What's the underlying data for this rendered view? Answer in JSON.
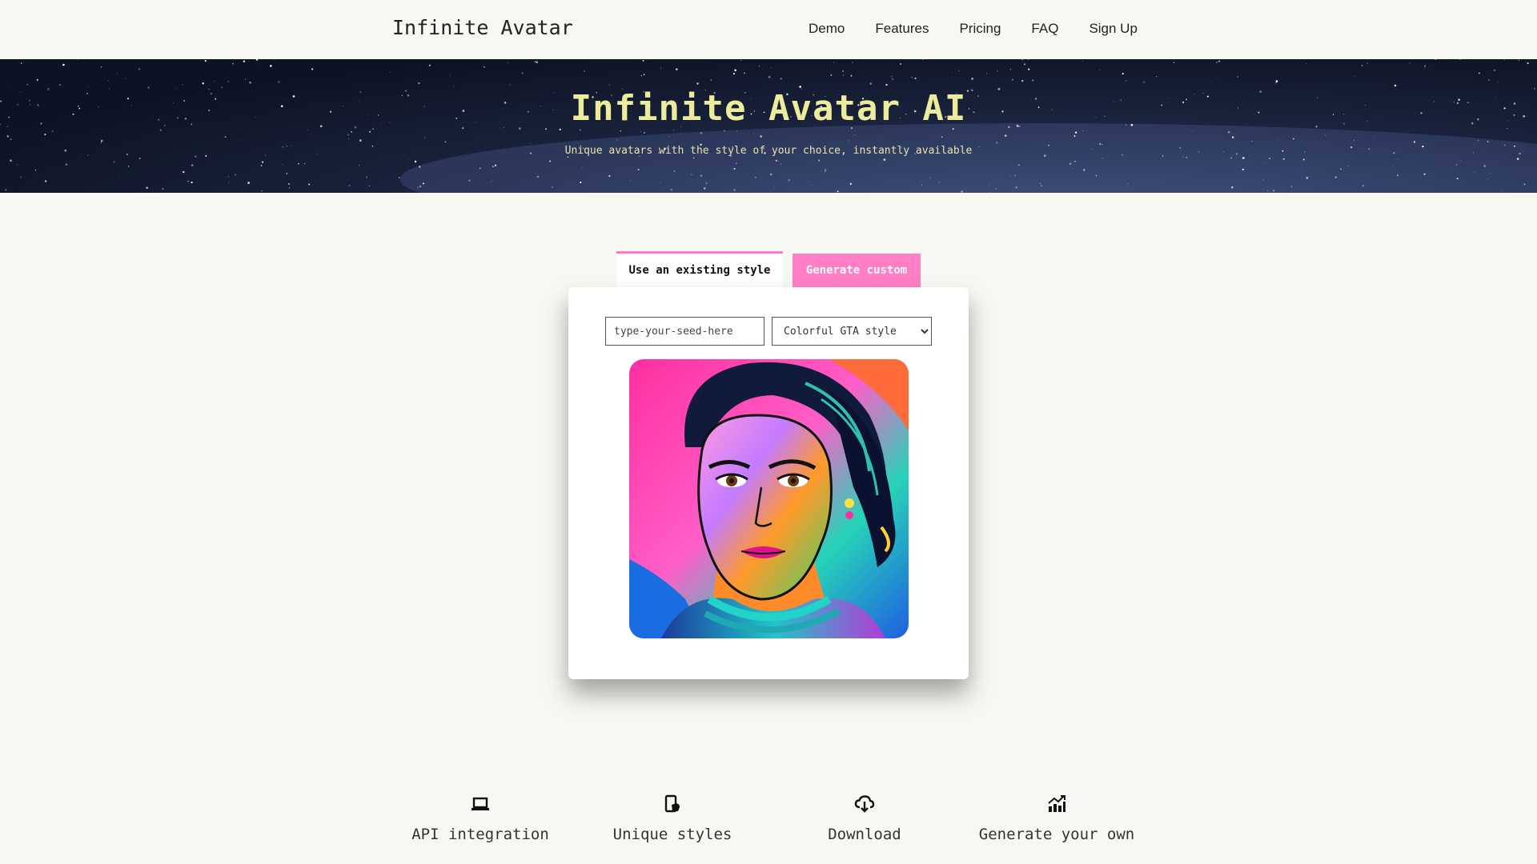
{
  "navbar": {
    "brand": "Infinite Avatar",
    "links": [
      "Demo",
      "Features",
      "Pricing",
      "FAQ",
      "Sign Up"
    ]
  },
  "hero": {
    "title": "Infinite Avatar AI",
    "subtitle": "Unique avatars with the style of your choice, instantly available"
  },
  "tabs": {
    "active": "Use an existing style",
    "inactive": "Generate custom"
  },
  "generator": {
    "seed_placeholder": "type-your-seed-here",
    "style_selected": "Colorful GTA style"
  },
  "avatar_image": {
    "description_icon": "generated-avatar-portrait"
  },
  "features": [
    {
      "label": "API integration",
      "icon": "laptop-icon"
    },
    {
      "label": "Unique styles",
      "icon": "phone-hand-icon"
    },
    {
      "label": "Download",
      "icon": "cloud-download-icon"
    },
    {
      "label": "Generate your own",
      "icon": "chart-growth-icon"
    }
  ],
  "colors": {
    "accent_pink": "#ff7ec5",
    "hero_text": "#ecec9c",
    "background": "#f8f8f3"
  }
}
